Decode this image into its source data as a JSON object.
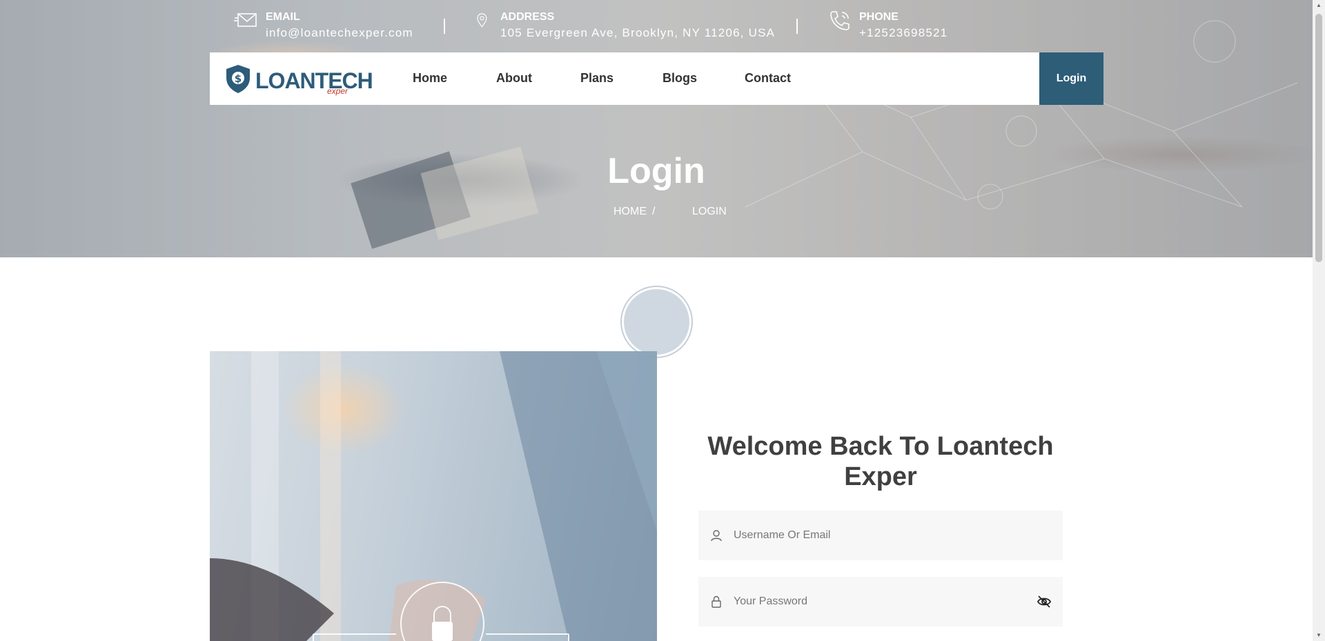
{
  "contact": {
    "email": {
      "title": "EMAIL",
      "value": "info@loantechexper.com"
    },
    "address": {
      "title": "ADDRESS",
      "value": "105 Evergreen Ave, Brooklyn, NY 11206, USA"
    },
    "phone": {
      "title": "PHONE",
      "value": "+12523698521"
    }
  },
  "logo": {
    "main": "LOANTECH",
    "sub": "exper"
  },
  "nav": {
    "items": [
      "Home",
      "About",
      "Plans",
      "Blogs",
      "Contact"
    ],
    "login_label": "Login"
  },
  "hero": {
    "title": "Login",
    "breadcrumb": {
      "home": "HOME",
      "separator": "/",
      "current": "LOGIN"
    }
  },
  "form": {
    "heading": "Welcome Back To Loantech Exper",
    "username_placeholder": "Username Or Email",
    "password_placeholder": "Your Password"
  },
  "colors": {
    "accent": "#2e5d78",
    "logo_sub": "#c0392b"
  },
  "icons": [
    "mail-icon",
    "location-pin-icon",
    "phone-icon",
    "user-icon",
    "lock-icon",
    "eye-slash-icon"
  ]
}
